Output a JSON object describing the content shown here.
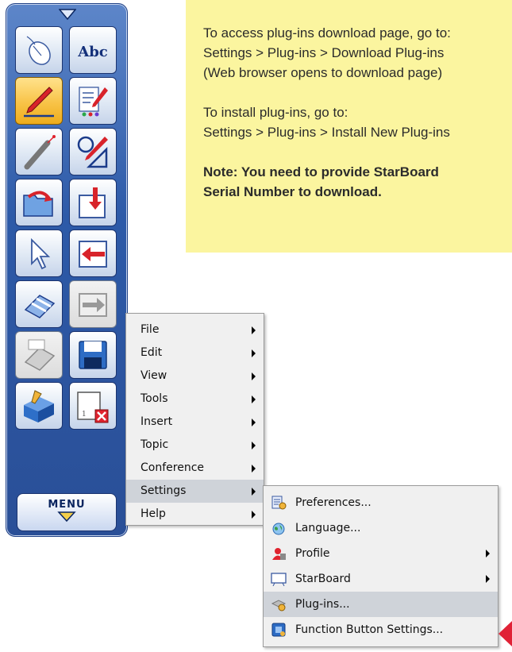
{
  "note": {
    "line1": "To access plug-ins download page, go to:",
    "line2": "Settings > Plug-ins > Download Plug-ins",
    "line3": "(Web browser opens to download page)",
    "line4": "To install plug-ins, go to:",
    "line5": "Settings > Plug-ins > Install New Plug-ins",
    "line6": "Note: You need to provide StarBoard",
    "line7": "Serial Number to download."
  },
  "toolbar": {
    "menu_label": "MENU",
    "tools": [
      {
        "icon": "mouse-pointer-icon"
      },
      {
        "icon": "text-abc-icon",
        "text": "Abc"
      },
      {
        "icon": "pen-icon",
        "state": "active"
      },
      {
        "icon": "pen-settings-icon"
      },
      {
        "icon": "laser-pointer-icon"
      },
      {
        "icon": "shape-pen-icon"
      },
      {
        "icon": "open-folder-icon"
      },
      {
        "icon": "page-in-icon"
      },
      {
        "icon": "select-arrow-icon"
      },
      {
        "icon": "page-back-icon"
      },
      {
        "icon": "eraser-icon"
      },
      {
        "icon": "next-page-icon",
        "state": "disabled"
      },
      {
        "icon": "clear-eraser-icon",
        "state": "disabled"
      },
      {
        "icon": "save-icon"
      },
      {
        "icon": "toolbox-icon"
      },
      {
        "icon": "close-board-icon"
      }
    ]
  },
  "main_menu": {
    "items": [
      {
        "label": "File",
        "submenu": true
      },
      {
        "label": "Edit",
        "submenu": true
      },
      {
        "label": "View",
        "submenu": true
      },
      {
        "label": "Tools",
        "submenu": true
      },
      {
        "label": "Insert",
        "submenu": true
      },
      {
        "label": "Topic",
        "submenu": true
      },
      {
        "label": "Conference",
        "submenu": true
      },
      {
        "label": "Settings",
        "submenu": true,
        "highlighted": true
      },
      {
        "label": "Help",
        "submenu": true
      }
    ]
  },
  "settings_menu": {
    "items": [
      {
        "label": "Preferences...",
        "icon": "preferences-icon"
      },
      {
        "label": "Language...",
        "icon": "language-icon"
      },
      {
        "label": "Profile",
        "icon": "profile-icon",
        "submenu": true
      },
      {
        "label": "StarBoard",
        "icon": "starboard-icon",
        "submenu": true
      },
      {
        "label": "Plug-ins...",
        "icon": "plugins-icon",
        "highlighted": true
      },
      {
        "label": "Function Button Settings...",
        "icon": "function-button-icon"
      }
    ]
  },
  "colors": {
    "note_bg": "#fbf59f",
    "toolbar_blue": "#2d5aa8",
    "active_tool": "#f8c347",
    "menu_bg": "#f0f0f0",
    "highlight": "#cfd3d9",
    "pointer_red": "#e02236"
  }
}
